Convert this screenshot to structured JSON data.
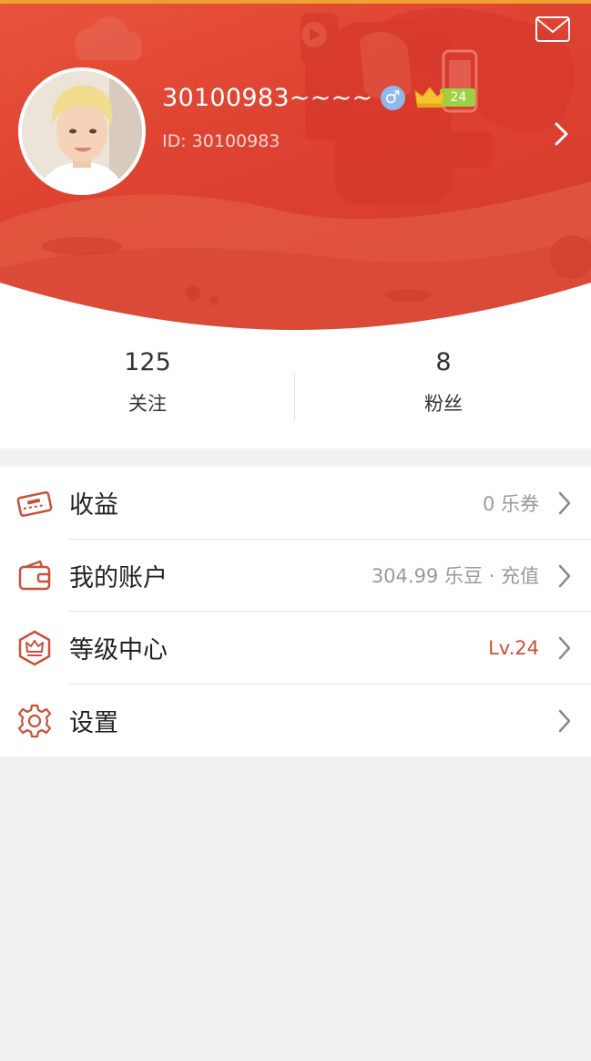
{
  "header": {
    "username": "30100983~~~~",
    "gender_symbol": "♂",
    "level_badge": "24",
    "user_id": "ID: 30100983",
    "icons": {
      "mail": "mail-icon",
      "arrow": "chevron-right-icon",
      "crown": "crown-icon",
      "gender": "male-icon"
    }
  },
  "stats": {
    "following": {
      "count": "125",
      "label": "关注"
    },
    "followers": {
      "count": "8",
      "label": "粉丝"
    }
  },
  "menu": {
    "items": [
      {
        "label": "收益",
        "value": "0 乐券",
        "icon": "ticket-icon"
      },
      {
        "label": "我的账户",
        "value": "304.99 乐豆 · 充值",
        "icon": "wallet-icon"
      },
      {
        "label": "等级中心",
        "value": "Lv.24",
        "icon": "level-crown-icon"
      },
      {
        "label": "设置",
        "value": "",
        "icon": "gear-icon"
      }
    ]
  },
  "colors": {
    "header_red": "#dd4131",
    "accent": "#c9513a",
    "level_green": "#9cd045",
    "gender_blue": "#8fb8ec",
    "top_bar": "#f0a030"
  }
}
